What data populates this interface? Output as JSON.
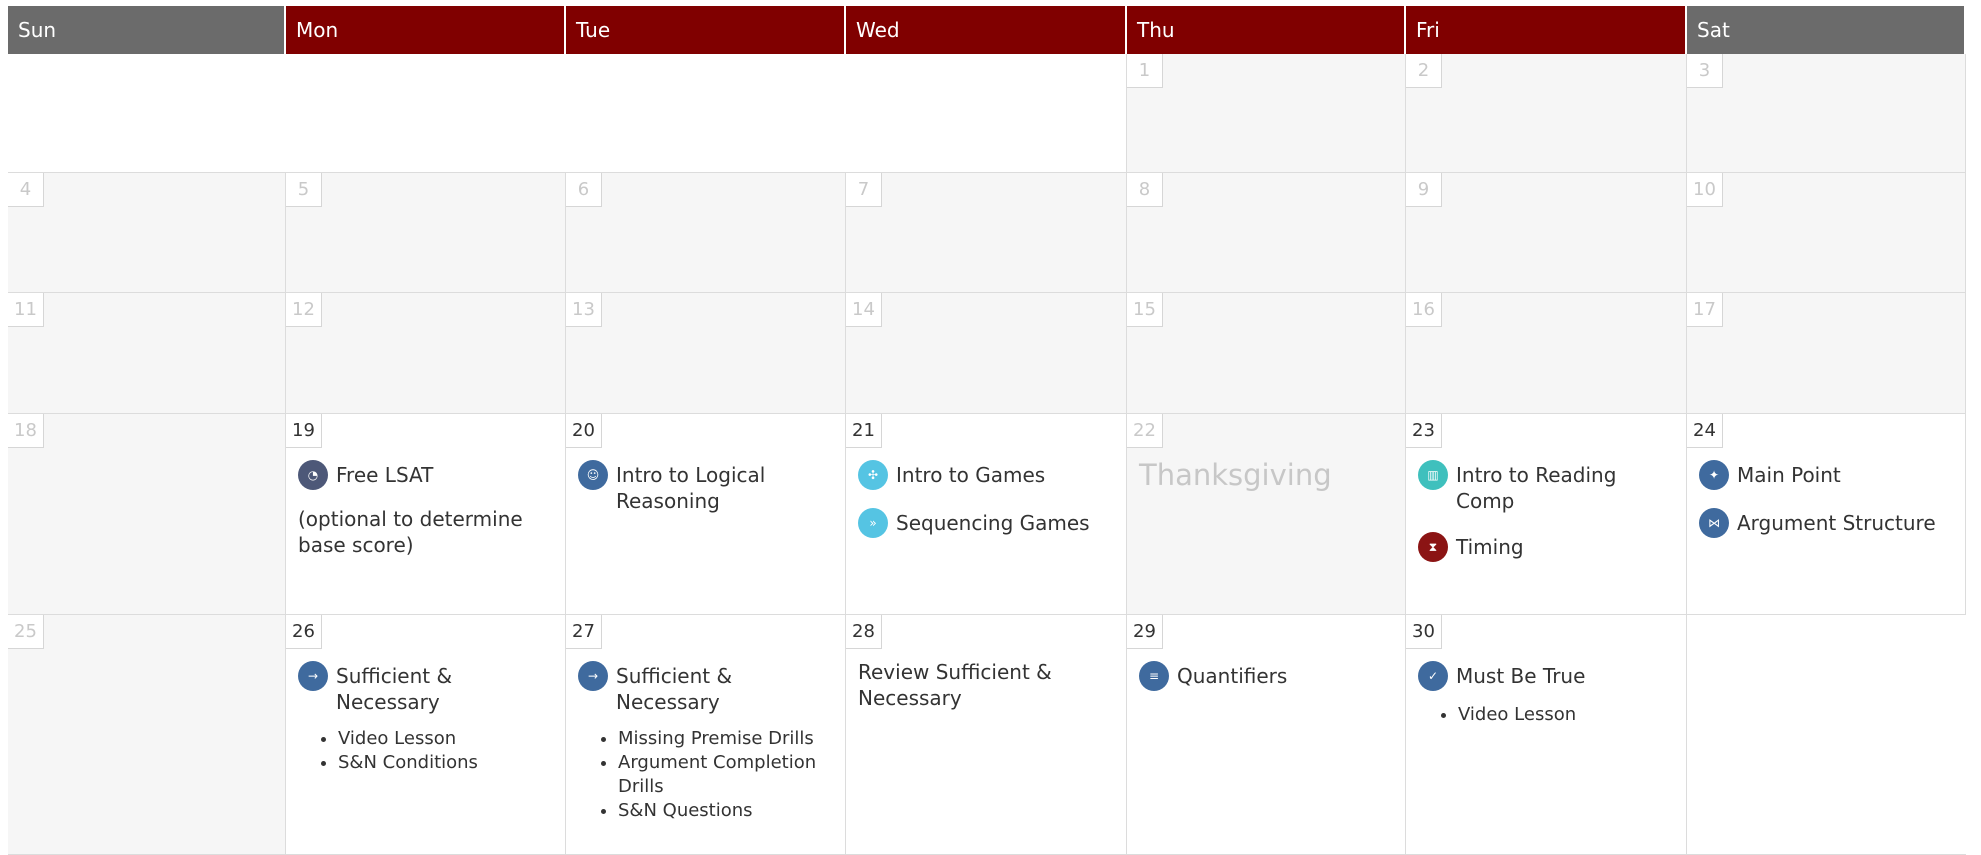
{
  "headers": [
    "Sun",
    "Mon",
    "Tue",
    "Wed",
    "Thu",
    "Fri",
    "Sat"
  ],
  "colors": {
    "header_weekday": "#800000",
    "header_weekend": "#6b6b6b"
  },
  "weeks": [
    [
      {
        "day": "",
        "state": "empty"
      },
      {
        "day": "",
        "state": "empty"
      },
      {
        "day": "",
        "state": "empty"
      },
      {
        "day": "",
        "state": "empty"
      },
      {
        "day": "1",
        "state": "past"
      },
      {
        "day": "2",
        "state": "past"
      },
      {
        "day": "3",
        "state": "past"
      }
    ],
    [
      {
        "day": "4",
        "state": "past"
      },
      {
        "day": "5",
        "state": "past"
      },
      {
        "day": "6",
        "state": "past"
      },
      {
        "day": "7",
        "state": "past"
      },
      {
        "day": "8",
        "state": "past"
      },
      {
        "day": "9",
        "state": "past"
      },
      {
        "day": "10",
        "state": "past"
      }
    ],
    [
      {
        "day": "11",
        "state": "past"
      },
      {
        "day": "12",
        "state": "past"
      },
      {
        "day": "13",
        "state": "past"
      },
      {
        "day": "14",
        "state": "past"
      },
      {
        "day": "15",
        "state": "past"
      },
      {
        "day": "16",
        "state": "past"
      },
      {
        "day": "17",
        "state": "past"
      }
    ],
    [
      {
        "day": "18",
        "state": "past"
      },
      {
        "day": "19",
        "state": "active",
        "items": [
          {
            "icon": "clock-icon",
            "color": "c-dark",
            "label": "Free LSAT"
          }
        ],
        "note": "(optional to determine base score)"
      },
      {
        "day": "20",
        "state": "active",
        "items": [
          {
            "icon": "head-icon",
            "color": "c-blue",
            "label": "Intro to Logical Reasoning"
          }
        ]
      },
      {
        "day": "21",
        "state": "active",
        "items": [
          {
            "icon": "puzzle-icon",
            "color": "c-cyan",
            "label": "Intro to Games"
          },
          {
            "icon": "sequence-icon",
            "color": "c-cyan",
            "label": "Sequencing Games"
          }
        ]
      },
      {
        "day": "22",
        "state": "holiday",
        "holiday": "Thanksgiving"
      },
      {
        "day": "23",
        "state": "active",
        "items": [
          {
            "icon": "book-icon",
            "color": "c-teal",
            "label": "Intro to Reading Comp"
          },
          {
            "icon": "hourglass-icon",
            "color": "c-red",
            "label": "Timing"
          }
        ]
      },
      {
        "day": "24",
        "state": "active",
        "items": [
          {
            "icon": "lightbulb-icon",
            "color": "c-blue",
            "label": "Main Point"
          },
          {
            "icon": "structure-icon",
            "color": "c-blue",
            "label": "Argument Structure"
          }
        ]
      }
    ],
    [
      {
        "day": "25",
        "state": "past"
      },
      {
        "day": "26",
        "state": "active",
        "items": [
          {
            "icon": "sufficient-necessary-icon",
            "color": "c-blue",
            "label": "Sufficient & Necessary"
          }
        ],
        "bullets": [
          "Video Lesson",
          "S&N Conditions"
        ]
      },
      {
        "day": "27",
        "state": "active",
        "items": [
          {
            "icon": "sufficient-necessary-icon",
            "color": "c-blue",
            "label": "Sufficient & Necessary"
          }
        ],
        "bullets": [
          "Missing Premise Drills",
          "Argument Completion Drills",
          "S&N Questions"
        ]
      },
      {
        "day": "28",
        "state": "active",
        "note": "Review Sufficient & Necessary"
      },
      {
        "day": "29",
        "state": "active",
        "items": [
          {
            "icon": "quantifier-icon",
            "color": "c-blue",
            "label": "Quantifiers"
          }
        ]
      },
      {
        "day": "30",
        "state": "active",
        "items": [
          {
            "icon": "checkmark-icon",
            "color": "c-blue",
            "label": "Must Be True"
          }
        ],
        "bullets": [
          "Video Lesson"
        ]
      },
      {
        "day": "",
        "state": "empty"
      }
    ]
  ]
}
